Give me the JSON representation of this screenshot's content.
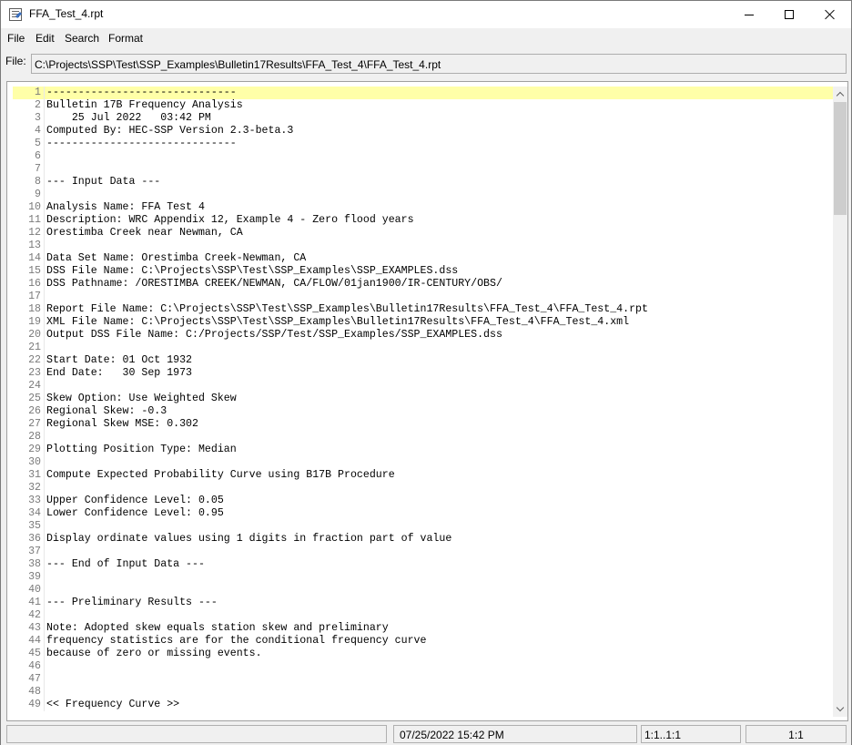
{
  "window": {
    "title": "FFA_Test_4.rpt"
  },
  "menu": {
    "items": [
      {
        "label": "File"
      },
      {
        "label": "Edit"
      },
      {
        "label": "Search"
      },
      {
        "label": "Format"
      }
    ]
  },
  "file": {
    "label": "File:",
    "path": "C:\\Projects\\SSP\\Test\\SSP_Examples\\Bulletin17Results\\FFA_Test_4\\FFA_Test_4.rpt"
  },
  "editor": {
    "current_line": 1,
    "lines": [
      "------------------------------",
      "Bulletin 17B Frequency Analysis",
      "    25 Jul 2022   03:42 PM",
      "Computed By: HEC-SSP Version 2.3-beta.3",
      "------------------------------",
      "",
      "",
      "--- Input Data ---",
      "",
      "Analysis Name: FFA Test 4",
      "Description: WRC Appendix 12, Example 4 - Zero flood years",
      "Orestimba Creek near Newman, CA",
      "",
      "Data Set Name: Orestimba Creek-Newman, CA",
      "DSS File Name: C:\\Projects\\SSP\\Test\\SSP_Examples\\SSP_EXAMPLES.dss",
      "DSS Pathname: /ORESTIMBA CREEK/NEWMAN, CA/FLOW/01jan1900/IR-CENTURY/OBS/",
      "",
      "Report File Name: C:\\Projects\\SSP\\Test\\SSP_Examples\\Bulletin17Results\\FFA_Test_4\\FFA_Test_4.rpt",
      "XML File Name: C:\\Projects\\SSP\\Test\\SSP_Examples\\Bulletin17Results\\FFA_Test_4\\FFA_Test_4.xml",
      "Output DSS File Name: C:/Projects/SSP/Test/SSP_Examples/SSP_EXAMPLES.dss",
      "",
      "Start Date: 01 Oct 1932",
      "End Date:   30 Sep 1973",
      "",
      "Skew Option: Use Weighted Skew",
      "Regional Skew: -0.3",
      "Regional Skew MSE: 0.302",
      "",
      "Plotting Position Type: Median",
      "",
      "Compute Expected Probability Curve using B17B Procedure",
      "",
      "Upper Confidence Level: 0.05",
      "Lower Confidence Level: 0.95",
      "",
      "Display ordinate values using 1 digits in fraction part of value",
      "",
      "--- End of Input Data ---",
      "",
      "",
      "--- Preliminary Results ---",
      "",
      "Note: Adopted skew equals station skew and preliminary",
      "frequency statistics are for the conditional frequency curve",
      "because of zero or missing events.",
      "",
      "",
      "",
      "<< Frequency Curve >>"
    ]
  },
  "status": {
    "cell1": "",
    "timestamp": "07/25/2022 15:42 PM",
    "selection": "1:1..1:1",
    "position": "1:1"
  }
}
